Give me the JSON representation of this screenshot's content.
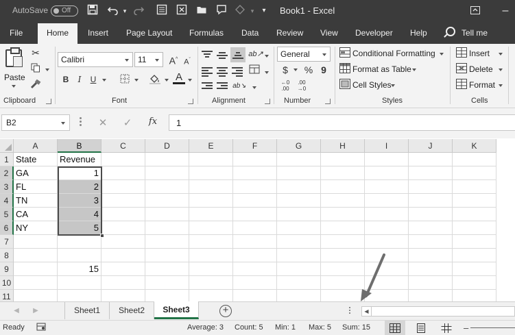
{
  "titlebar": {
    "autosave_label": "AutoSave",
    "autosave_state": "Off",
    "title": "Book1  -  Excel"
  },
  "tabs": [
    "File",
    "Home",
    "Insert",
    "Page Layout",
    "Formulas",
    "Data",
    "Review",
    "View",
    "Developer",
    "Help"
  ],
  "active_tab": "Home",
  "tell_me": "Tell me",
  "ribbon": {
    "clipboard": {
      "paste": "Paste",
      "label": "Clipboard"
    },
    "font": {
      "name": "Calibri",
      "size": "11",
      "label": "Font",
      "bold": "B",
      "italic": "I",
      "underline": "U"
    },
    "alignment": {
      "label": "Alignment"
    },
    "number": {
      "format": "General",
      "currency": "$",
      "percent": "%",
      "comma": "9",
      "label": "Number"
    },
    "styles": {
      "conditional": "Conditional Formatting",
      "table": "Format as Table",
      "cell_styles": "Cell Styles",
      "label": "Styles"
    },
    "cells": {
      "insert": "Insert",
      "delete": "Delete",
      "format": "Format",
      "label": "Cells"
    }
  },
  "formula_bar": {
    "name_box": "B2",
    "fx": "fx",
    "value": "1"
  },
  "columns": [
    "A",
    "B",
    "C",
    "D",
    "E",
    "F",
    "G",
    "H",
    "I",
    "J",
    "K"
  ],
  "selected_column": "B",
  "rows": [
    {
      "n": "1",
      "A": "State",
      "B": "Revenue"
    },
    {
      "n": "2",
      "A": "GA",
      "B": "1"
    },
    {
      "n": "3",
      "A": "FL",
      "B": "2"
    },
    {
      "n": "4",
      "A": "TN",
      "B": "3"
    },
    {
      "n": "5",
      "A": "CA",
      "B": "4"
    },
    {
      "n": "6",
      "A": "NY",
      "B": "5"
    },
    {
      "n": "7",
      "A": "",
      "B": ""
    },
    {
      "n": "8",
      "A": "",
      "B": ""
    },
    {
      "n": "9",
      "A": "",
      "B": "15"
    },
    {
      "n": "10",
      "A": "",
      "B": ""
    },
    {
      "n": "11",
      "A": "",
      "B": ""
    }
  ],
  "sheets": [
    "Sheet1",
    "Sheet2",
    "Sheet3"
  ],
  "active_sheet": "Sheet3",
  "status": {
    "ready": "Ready",
    "average": "Average: 3",
    "count": "Count: 5",
    "min": "Min: 1",
    "max": "Max: 5",
    "sum": "Sum: 15"
  },
  "icons": {
    "save": "save-icon",
    "undo": "undo-icon",
    "redo": "redo-icon",
    "cut": "scissors-icon",
    "copy": "copy-icon",
    "format_painter": "brush-icon",
    "search": "search-icon"
  },
  "colors": {
    "titlebar": "#3b3b3b",
    "ribbon": "#f3f3f3",
    "accent": "#217346",
    "selection": "#c6c6c6"
  }
}
